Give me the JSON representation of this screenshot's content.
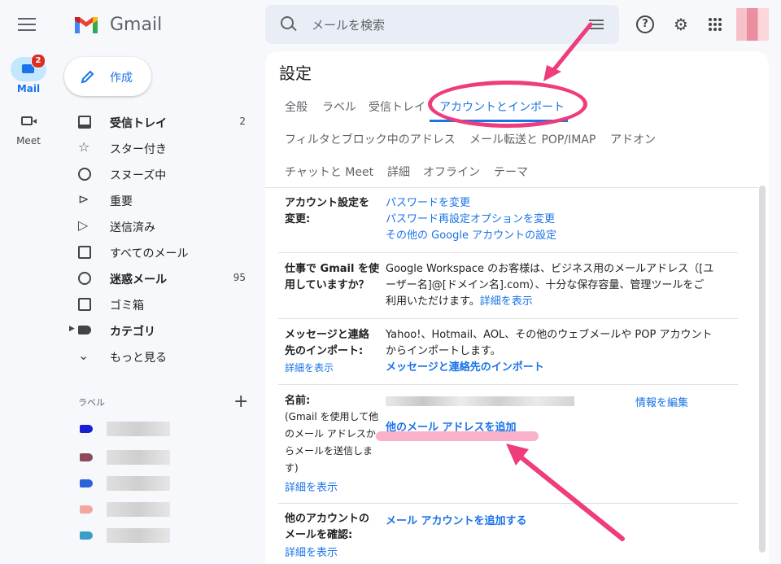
{
  "rail": {
    "mail_label": "Mail",
    "mail_badge": "2",
    "meet_label": "Meet"
  },
  "logo": {
    "text": "Gmail"
  },
  "compose": {
    "label": "作成"
  },
  "nav": [
    {
      "label": "受信トレイ",
      "count": "2",
      "icon": "inbox-icon",
      "bold": true
    },
    {
      "label": "スター付き",
      "count": "",
      "icon": "star-icon"
    },
    {
      "label": "スヌーズ中",
      "count": "",
      "icon": "clock-icon"
    },
    {
      "label": "重要",
      "count": "",
      "icon": "important-icon"
    },
    {
      "label": "送信済み",
      "count": "",
      "icon": "send-icon"
    },
    {
      "label": "すべてのメール",
      "count": "",
      "icon": "mail-icon"
    },
    {
      "label": "迷惑メール",
      "count": "95",
      "icon": "spam-icon",
      "bold": true
    },
    {
      "label": "ゴミ箱",
      "count": "",
      "icon": "trash-icon"
    },
    {
      "label": "カテゴリ",
      "count": "",
      "icon": "label-icon",
      "bold": true
    },
    {
      "label": "もっと見る",
      "count": "",
      "icon": "chevron-down-icon"
    }
  ],
  "labels": {
    "heading": "ラベル",
    "colors": [
      "#1a1fd1",
      "#8c4a5a",
      "#2a62d9",
      "#f4a6a0",
      "#3a9fc7"
    ]
  },
  "search": {
    "placeholder": "メールを検索"
  },
  "settings": {
    "title": "設定",
    "tabs_row1": [
      "全般",
      "ラベル",
      "受信トレイ",
      "アカウントとインポート"
    ],
    "tabs_row2": [
      "フィルタとブロック中のアドレス",
      "メール転送と POP/IMAP",
      "アドオン"
    ],
    "tabs_row3": [
      "チャットと Meet",
      "詳細",
      "オフライン",
      "テーマ"
    ],
    "rows": {
      "change_label_1": "アカウント設定を",
      "change_label_2": "変更:",
      "change_link_1": "パスワードを変更",
      "change_link_2": "パスワード再設定オプションを変更",
      "change_link_3": "その他の Google アカウントの設定",
      "work_label_1": "仕事で Gmail を使",
      "work_label_2": "用していますか？",
      "work_text_1": "Google Workspace のお客様は、ビジネス用のメールアドレス（[ユ",
      "work_text_2": "ーザー名]@[ドメイン名].com）、十分な保存容量、管理ツールをご",
      "work_text_3": "利用いただけます。",
      "work_link": "詳細を表示",
      "import_label_1": "メッセージと連絡",
      "import_label_2": "先のインポート:",
      "import_detail": "詳細を表示",
      "import_text_1": "Yahoo!、Hotmail、AOL、その他のウェブメールや POP アカウント",
      "import_text_2": "からインポートします。",
      "import_link": "メッセージと連絡先のインポート",
      "name_label": "名前:",
      "name_note_1": "(Gmail を使用して他",
      "name_note_2": "のメール アドレスか",
      "name_note_3": "らメールを送信しま",
      "name_note_4": "す)",
      "name_detail": "詳細を表示",
      "name_edit": "情報を編集",
      "name_add": "他のメール アドレスを追加",
      "check_label_1": "他のアカウントの",
      "check_label_2": "メールを確認:",
      "check_link": "メール アカウントを追加する",
      "check_detail": "詳細を表示"
    }
  },
  "annotation_color": "#ee3c7c"
}
